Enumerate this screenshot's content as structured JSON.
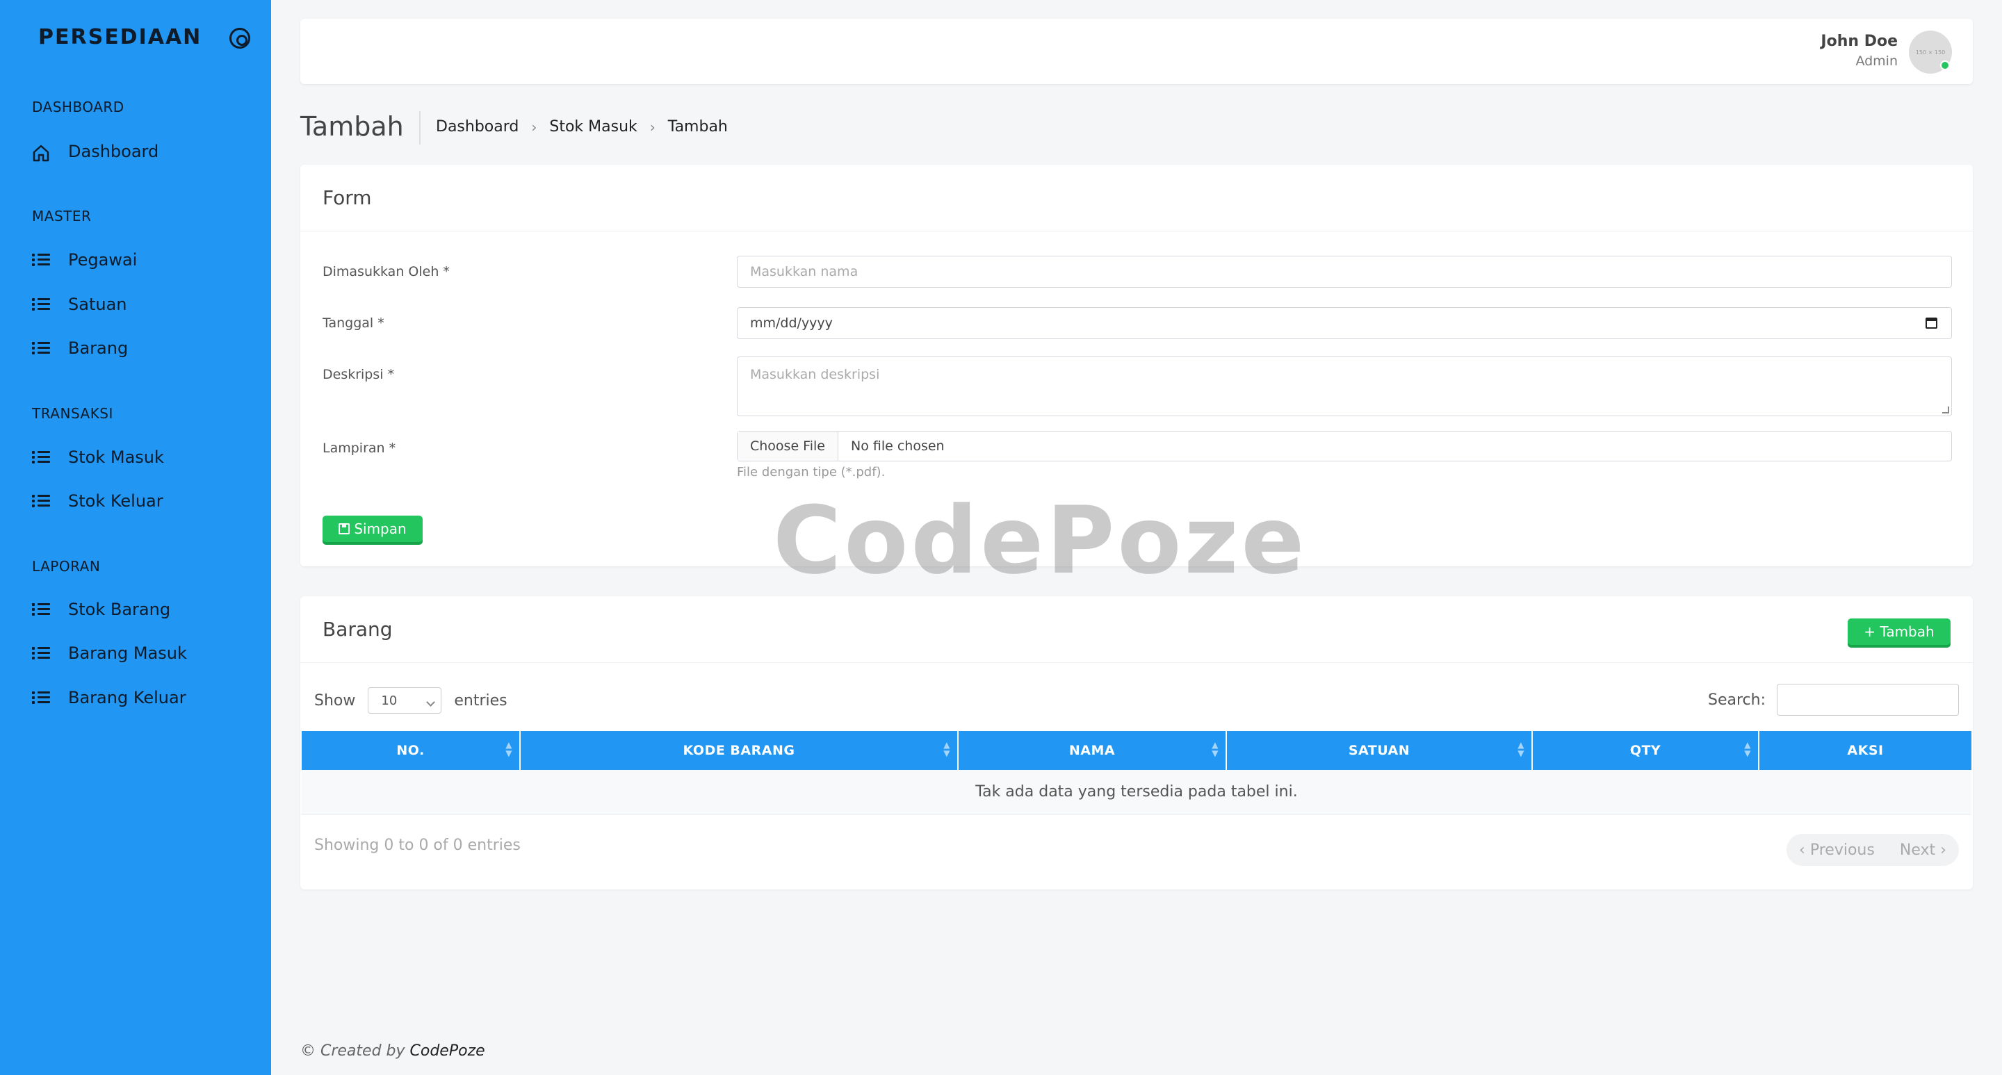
{
  "sidebar": {
    "brand": "PERSEDIAAN",
    "sections": [
      {
        "title": "DASHBOARD",
        "items": [
          {
            "label": "Dashboard",
            "icon": "home-icon"
          }
        ]
      },
      {
        "title": "MASTER",
        "items": [
          {
            "label": "Pegawai",
            "icon": "list-icon"
          },
          {
            "label": "Satuan",
            "icon": "list-icon"
          },
          {
            "label": "Barang",
            "icon": "list-icon"
          }
        ]
      },
      {
        "title": "TRANSAKSI",
        "items": [
          {
            "label": "Stok Masuk",
            "icon": "list-icon"
          },
          {
            "label": "Stok Keluar",
            "icon": "list-icon"
          }
        ]
      },
      {
        "title": "LAPORAN",
        "items": [
          {
            "label": "Stok Barang",
            "icon": "list-icon"
          },
          {
            "label": "Barang Masuk",
            "icon": "list-icon"
          },
          {
            "label": "Barang Keluar",
            "icon": "list-icon"
          }
        ]
      }
    ]
  },
  "header": {
    "user_name": "John Doe",
    "user_role": "Admin",
    "avatar_text": "150 × 150"
  },
  "page": {
    "title": "Tambah",
    "breadcrumb": [
      "Dashboard",
      "Stok Masuk",
      "Tambah"
    ]
  },
  "form": {
    "title": "Form",
    "fields": {
      "entered_by": {
        "label": "Dimasukkan Oleh *",
        "placeholder": "Masukkan nama"
      },
      "date": {
        "label": "Tanggal *",
        "placeholder": "mm/dd/yyyy"
      },
      "description": {
        "label": "Deskripsi *",
        "placeholder": "Masukkan deskripsi"
      },
      "attachment": {
        "label": "Lampiran *",
        "button": "Choose File",
        "status": "No file chosen",
        "help": "File dengan tipe (*.pdf)."
      }
    },
    "save_label": "Simpan"
  },
  "watermark": "CodePoze",
  "table_card": {
    "title": "Barang",
    "add_label": "+ Tambah",
    "show_label": "Show",
    "entries_value": "10",
    "entries_label": "entries",
    "search_label": "Search:",
    "columns": [
      "NO.",
      "KODE BARANG",
      "NAMA",
      "SATUAN",
      "QTY",
      "AKSI"
    ],
    "empty_text": "Tak ada data yang tersedia pada tabel ini.",
    "info": "Showing 0 to 0 of 0 entries",
    "prev_label": "‹ Previous",
    "next_label": "Next ›"
  },
  "footer": {
    "prefix": "© Created by ",
    "author": "CodePoze"
  },
  "colors": {
    "sidebar": "#2196f3",
    "accent_green": "#22c55e",
    "table_header": "#2196f3"
  }
}
